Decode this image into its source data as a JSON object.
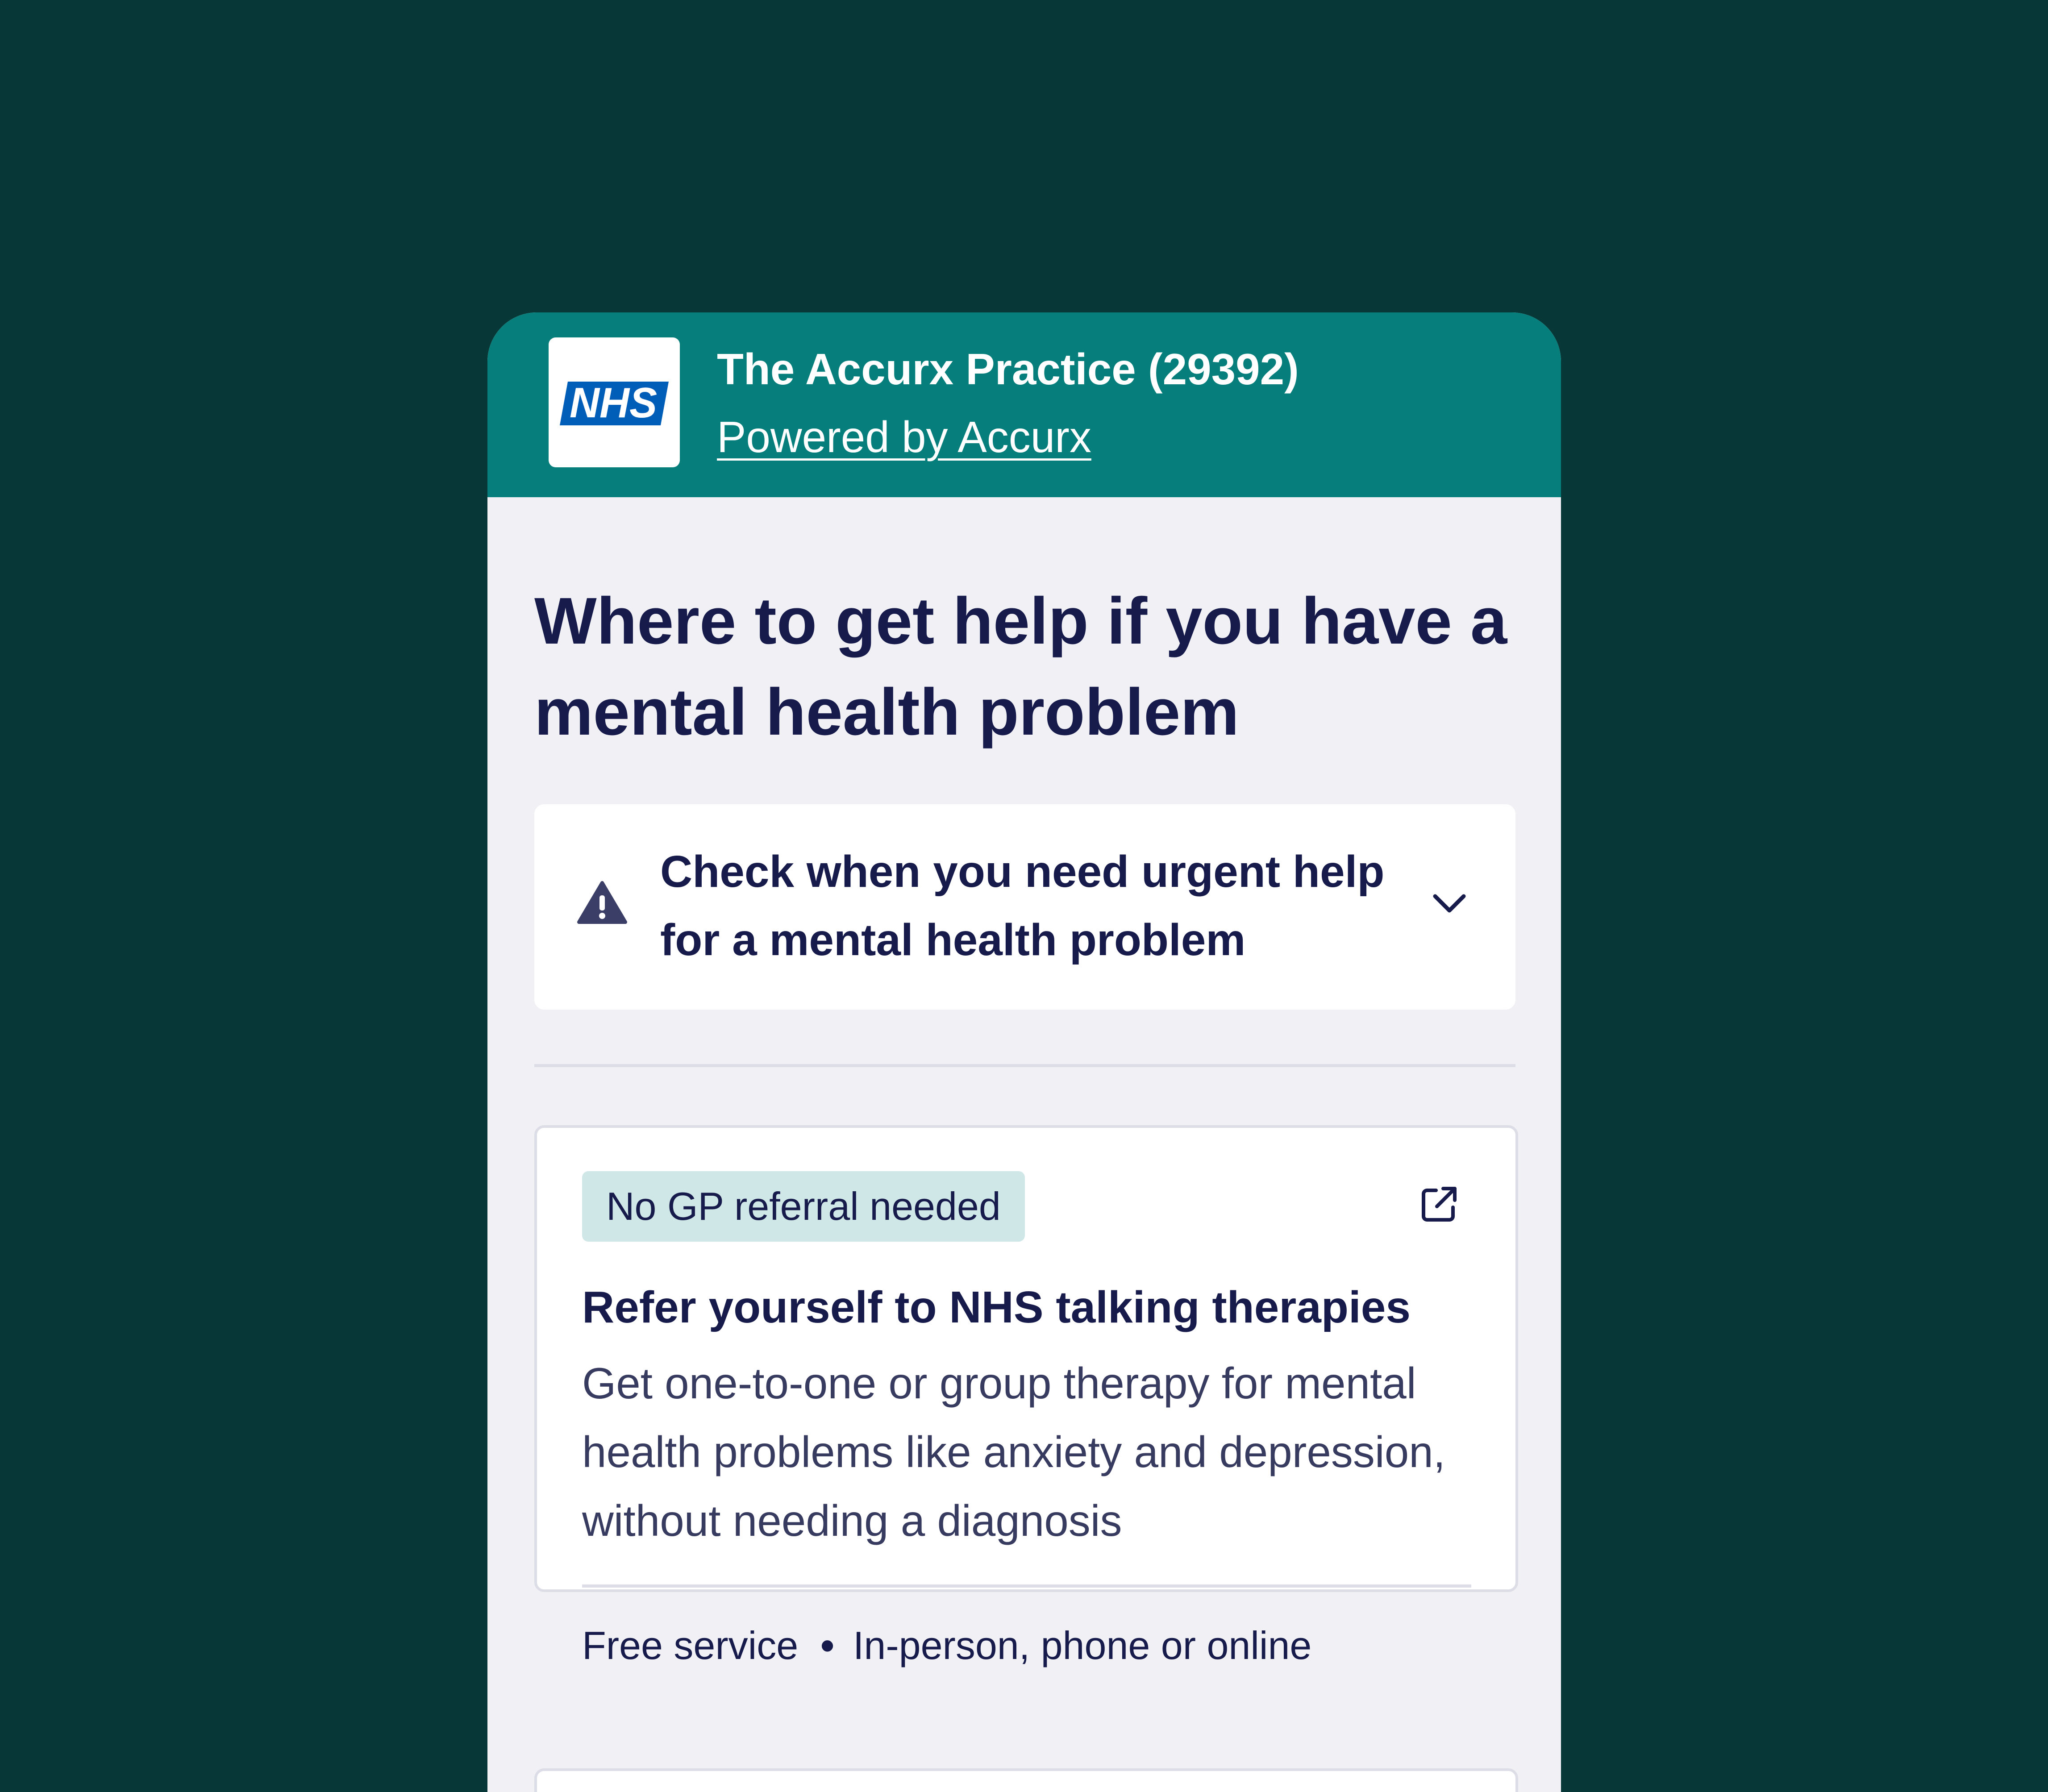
{
  "header": {
    "logo_text": "NHS",
    "practice_name": "The Accurx Practice (29392)",
    "powered_by": "Powered by Accurx"
  },
  "page": {
    "title": "Where to get help if you have a mental health problem"
  },
  "urgent_help": {
    "label": "Check when you need urgent help for a mental health problem",
    "icon": "warning-triangle-icon",
    "toggle_icon": "chevron-down-icon",
    "expanded": false
  },
  "service_card": {
    "badge": "No GP referral needed",
    "link_icon": "external-link-icon",
    "title": "Refer yourself to NHS talking therapies",
    "description": "Get one-to-one or group therapy for mental health problems like anxiety and depression, without needing a diagnosis",
    "cost": "Free service",
    "separator": "•",
    "access": "In-person, phone or online"
  },
  "colors": {
    "background": "#073737",
    "header": "#067f7c",
    "nhs_blue": "#005eb8",
    "page_bg": "#f1f1f5",
    "heading_text": "#171b4b",
    "body_text": "#383b60",
    "badge_bg": "#cfe8e7",
    "border": "#dcdde6"
  }
}
